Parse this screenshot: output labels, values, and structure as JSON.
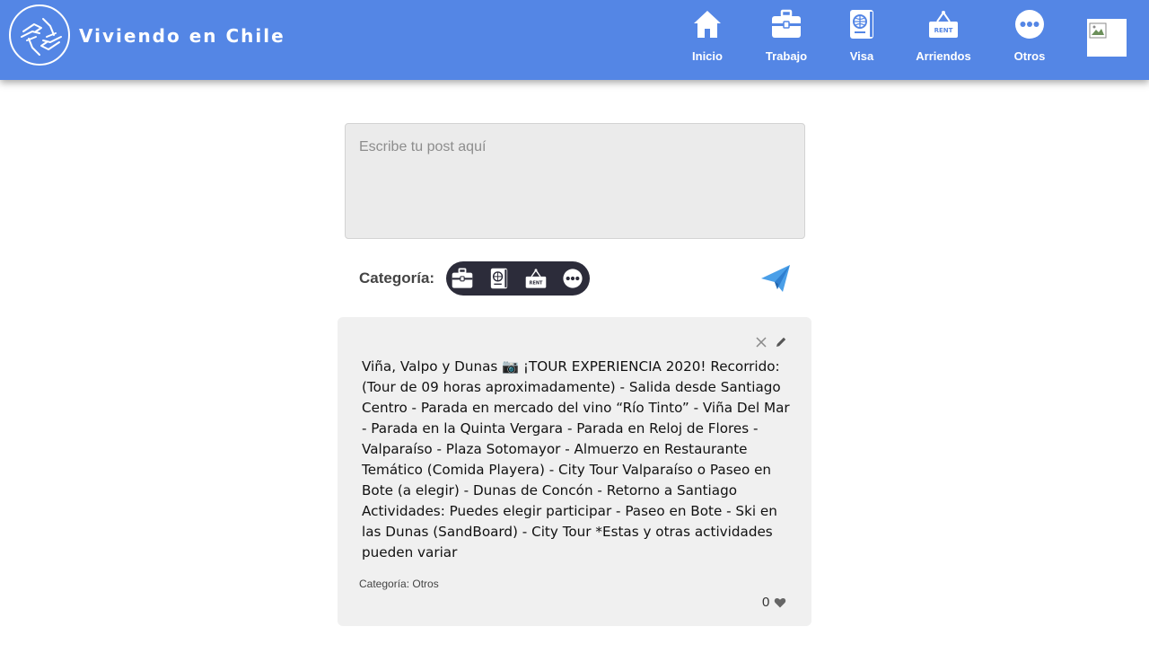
{
  "header": {
    "brand": "Viviendo en Chile",
    "nav": [
      {
        "label": "Inicio",
        "icon": "home-icon"
      },
      {
        "label": "Trabajo",
        "icon": "briefcase-icon"
      },
      {
        "label": "Visa",
        "icon": "passport-icon"
      },
      {
        "label": "Arriendos",
        "icon": "rent-sign-icon"
      },
      {
        "label": "Otros",
        "icon": "more-icon"
      }
    ],
    "profile_icon": "broken-image-icon",
    "rent_sign_text": "RENT"
  },
  "composer": {
    "placeholder": "Escribe tu post aquí"
  },
  "category": {
    "label": "Categoría:",
    "options": [
      "briefcase-icon",
      "passport-icon",
      "rent-sign-icon",
      "more-icon"
    ]
  },
  "send_icon": "paper-plane-icon",
  "post": {
    "text": "Viña, Valpo y Dunas 📷 ¡TOUR EXPERIENCIA 2020! Recorrido: (Tour de 09 horas aproximadamente) - Salida desde Santiago Centro - Parada en mercado del vino “Río Tinto” - Viña Del Mar - Parada en la Quinta Vergara - Parada en Reloj de Flores - Valparaíso - Plaza Sotomayor - Almuerzo en Restaurante Temático (Comida Playera) - City Tour Valparaíso o Paseo en Bote (a elegir) - Dunas de Concón - Retorno a Santiago Actividades: Puedes elegir participar - Paseo en Bote - Ski en las Dunas (SandBoard) - City Tour *Estas y otras actividades pueden variar",
    "category": "Categoría: Otros",
    "likes": "0"
  },
  "colors": {
    "header": "#5486e5",
    "pill": "#2c2c3a",
    "send": "#4a9fe8",
    "card": "#f0f0f0"
  }
}
